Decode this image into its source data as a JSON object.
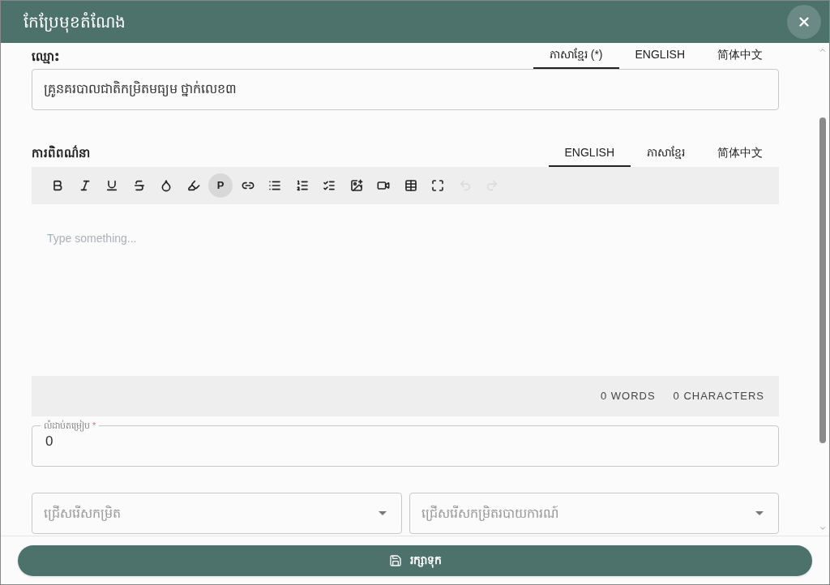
{
  "dialog": {
    "title": "កែប្រែមុខតំណែង"
  },
  "name_field": {
    "label": "ឈ្មោះ",
    "value": "គ្រូនគរបាលជាតិកម្រិតមធ្យម ថ្នាក់លេខ៣",
    "tabs": [
      {
        "label": "ភាសាខ្មែរ (*)",
        "selected": true
      },
      {
        "label": "ENGLISH",
        "selected": false
      },
      {
        "label": "简体中文",
        "selected": false
      }
    ]
  },
  "description": {
    "label": "ការពិពណ៌នា",
    "tabs": [
      {
        "label": "ENGLISH",
        "selected": true
      },
      {
        "label": "ភាសាខ្មែរ",
        "selected": false
      },
      {
        "label": "简体中文",
        "selected": false
      }
    ],
    "toolbar": [
      {
        "kind": "bold",
        "disabled": false
      },
      {
        "kind": "italic",
        "disabled": false
      },
      {
        "kind": "underline",
        "disabled": false
      },
      {
        "kind": "strike",
        "disabled": false
      },
      {
        "kind": "color",
        "disabled": false
      },
      {
        "kind": "highlight",
        "disabled": false
      },
      {
        "kind": "paragraph",
        "label": "P",
        "selected": true,
        "disabled": false
      },
      {
        "kind": "link",
        "disabled": false
      },
      {
        "kind": "bullet",
        "disabled": false
      },
      {
        "kind": "ordered",
        "disabled": false
      },
      {
        "kind": "tasks",
        "disabled": false
      },
      {
        "kind": "image",
        "disabled": false
      },
      {
        "kind": "video",
        "disabled": false
      },
      {
        "kind": "table",
        "disabled": false
      },
      {
        "kind": "fullscreen",
        "disabled": false
      },
      {
        "kind": "undo",
        "disabled": true
      },
      {
        "kind": "redo",
        "disabled": true
      }
    ],
    "placeholder": "Type something...",
    "words": "0 WORDS",
    "characters": "0 CHARACTERS"
  },
  "order_field": {
    "label": "លំដាប់តម្រៀប",
    "required_mark": "*",
    "value": "0"
  },
  "selects": [
    {
      "placeholder": "ជ្រើសរើសកម្រិត"
    },
    {
      "placeholder": "ជ្រើសរើសកម្រិតរបាយការណ៍"
    }
  ],
  "save_button": {
    "label": "រក្សាទុក"
  }
}
